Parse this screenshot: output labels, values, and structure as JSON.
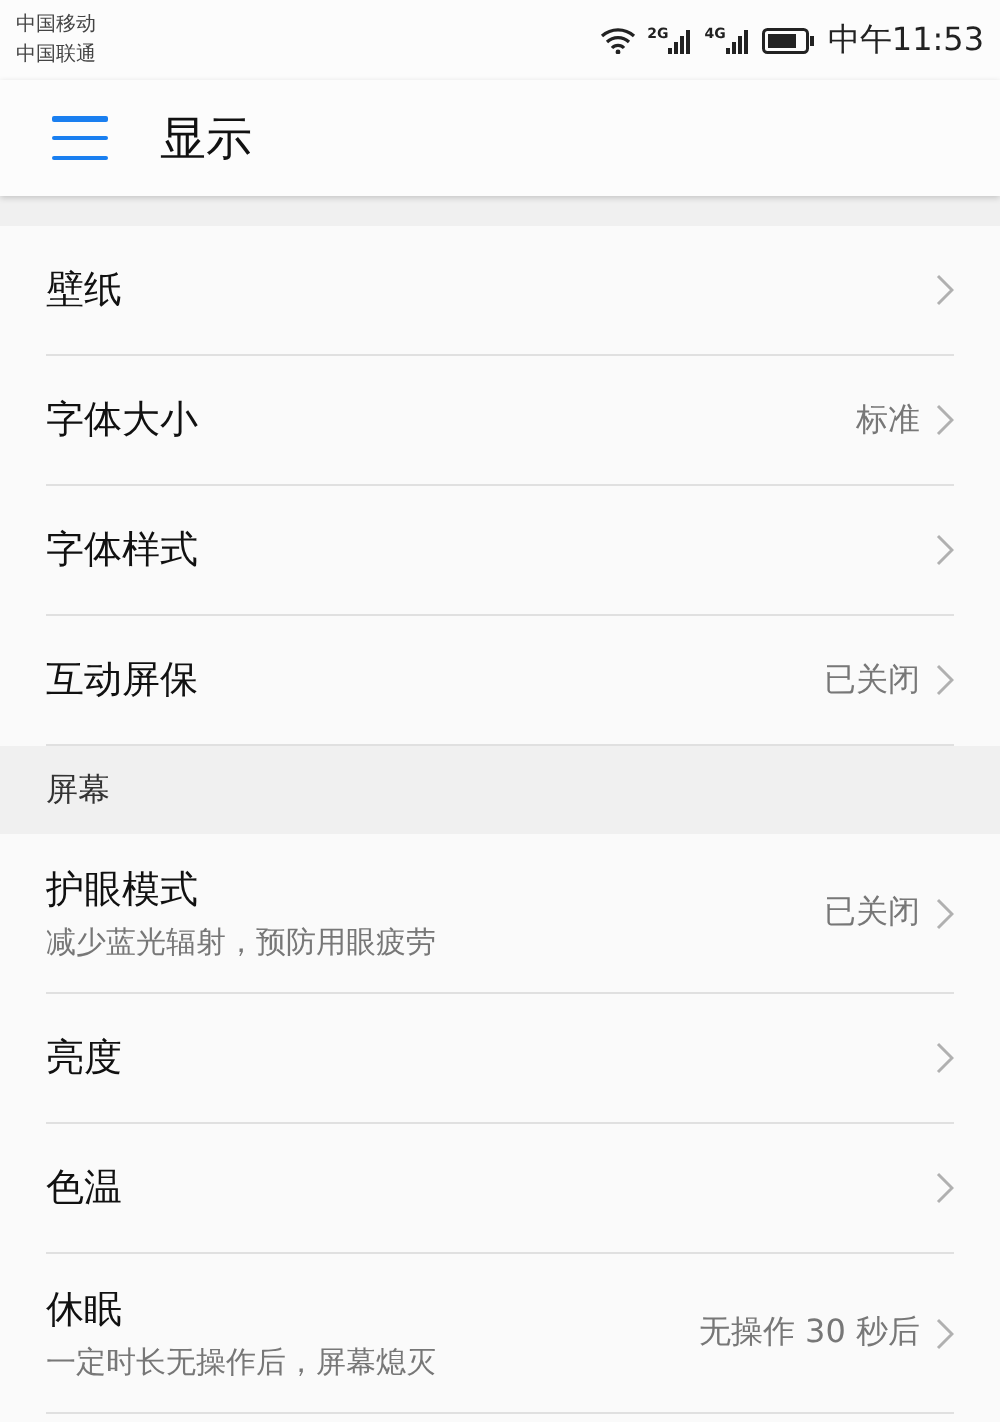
{
  "status_bar": {
    "carriers": [
      "中国移动",
      "中国联通"
    ],
    "network_labels": [
      "2G",
      "4G"
    ],
    "time": "中午11:53"
  },
  "toolbar": {
    "title": "显示"
  },
  "sections": [
    {
      "items": [
        {
          "title": "壁纸"
        },
        {
          "title": "字体大小",
          "value": "标准"
        },
        {
          "title": "字体样式"
        },
        {
          "title": "互动屏保",
          "value": "已关闭"
        }
      ]
    },
    {
      "header": "屏幕",
      "items": [
        {
          "title": "护眼模式",
          "subtitle": "减少蓝光辐射，预防用眼疲劳",
          "value": "已关闭"
        },
        {
          "title": "亮度"
        },
        {
          "title": "色温"
        },
        {
          "title": "休眠",
          "subtitle": "一定时长无操作后，屏幕熄灭",
          "value": "无操作 30 秒后"
        }
      ]
    }
  ]
}
